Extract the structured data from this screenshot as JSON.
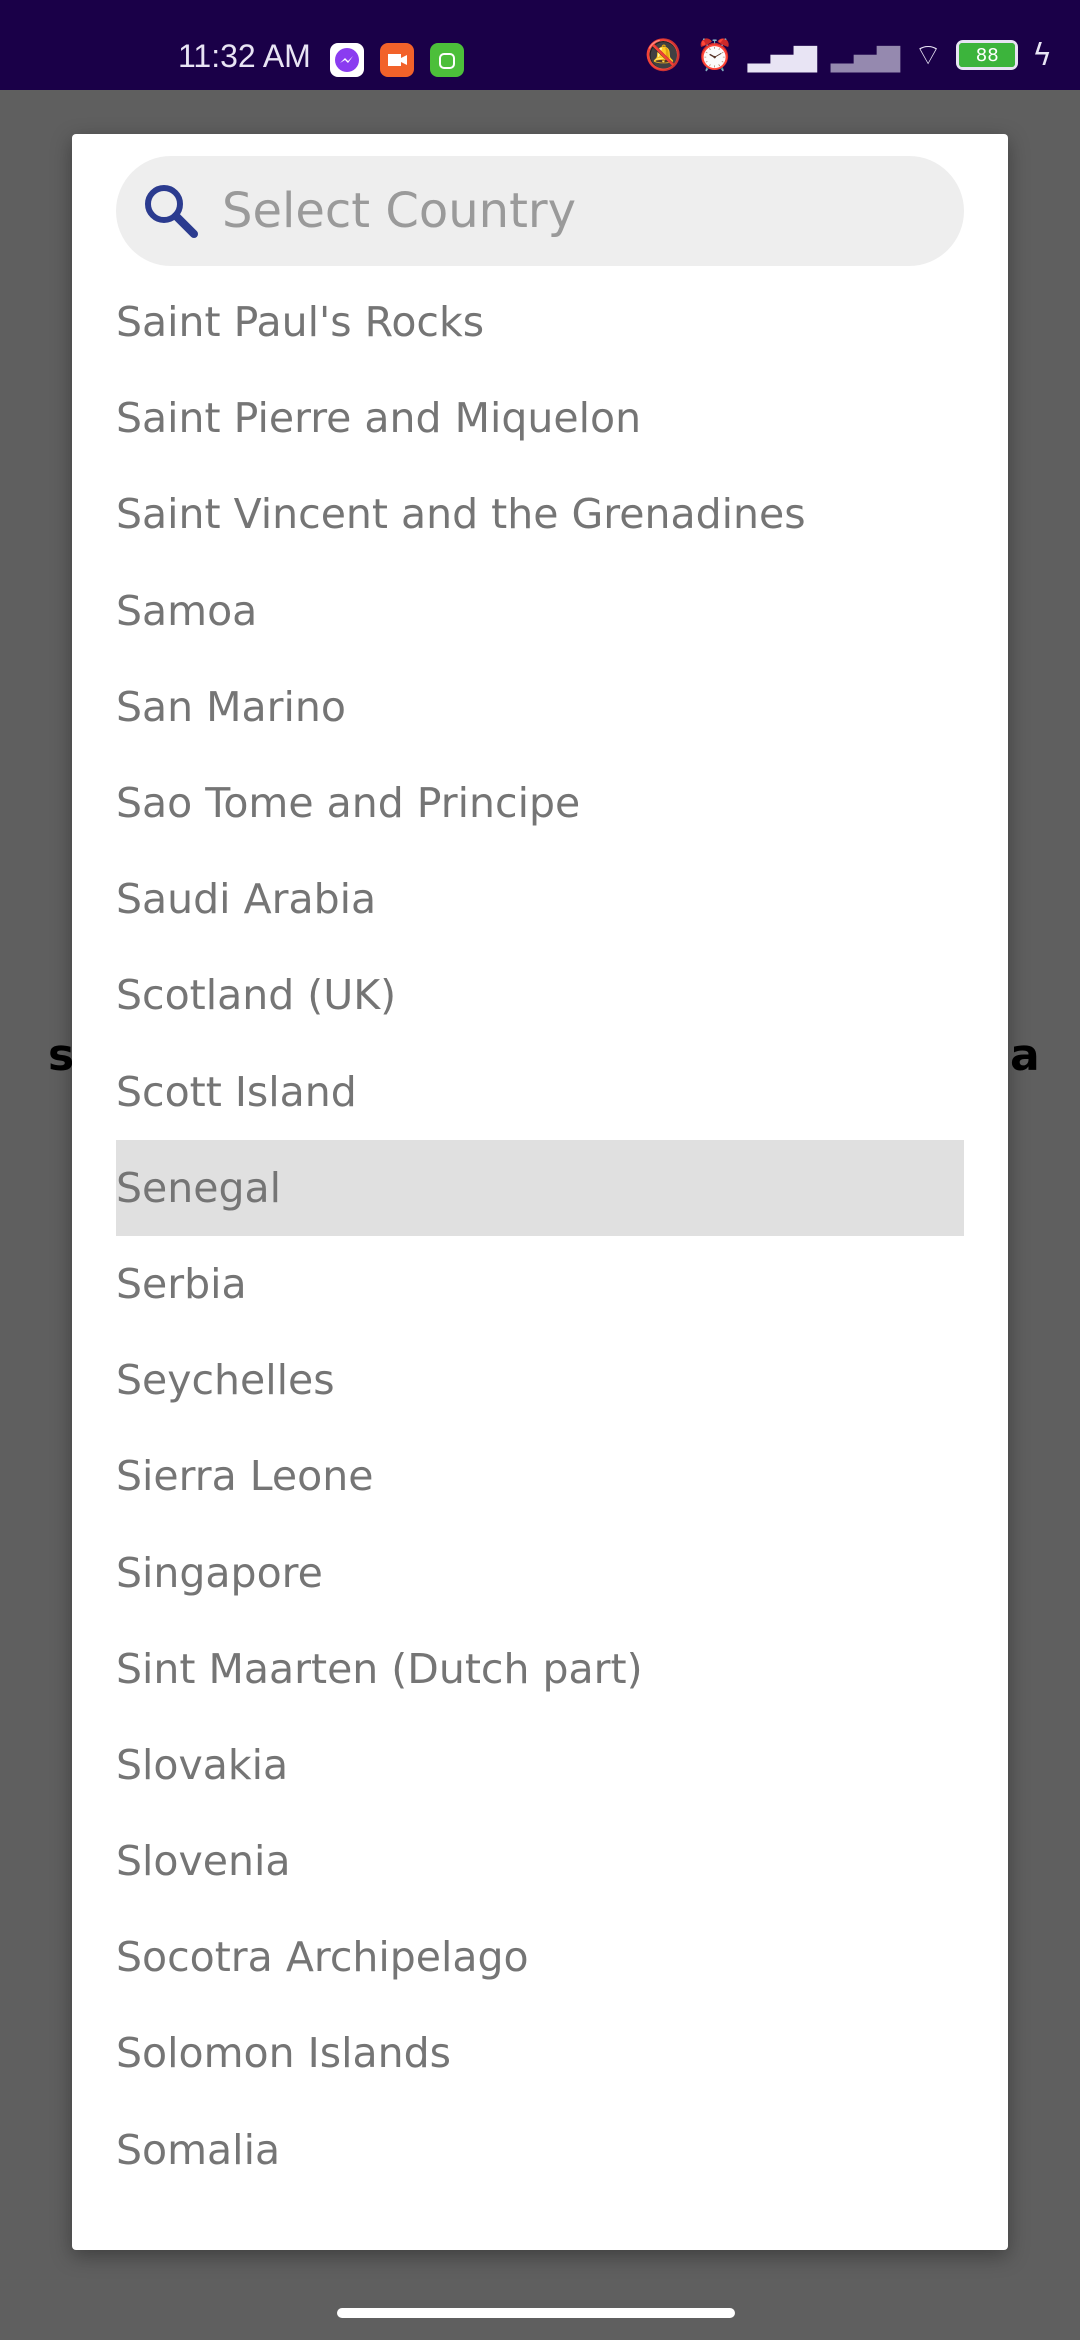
{
  "status_bar": {
    "time": "11:32 AM",
    "battery": "88",
    "notification_icons": [
      "messenger-icon",
      "video-call-icon",
      "android-app-icon"
    ],
    "system_icons": [
      "bell-muted-icon",
      "alarm-icon",
      "signal-icon",
      "signal-icon",
      "wifi-icon",
      "battery-icon",
      "charging-icon"
    ],
    "background_color": "#1a0048"
  },
  "background": {
    "fragment_left": "s",
    "fragment_right": "a"
  },
  "dialog": {
    "search": {
      "placeholder": "Select Country",
      "value": ""
    },
    "selected": "Senegal",
    "countries": [
      "Saint Paul's Rocks",
      "Saint Pierre and Miquelon",
      "Saint Vincent and the Grenadines",
      "Samoa",
      "San Marino",
      "Sao Tome and Principe",
      "Saudi Arabia",
      "Scotland (UK)",
      "Scott Island",
      "Senegal",
      "Serbia",
      "Seychelles",
      "Sierra Leone",
      "Singapore",
      "Sint Maarten (Dutch part)",
      "Slovakia",
      "Slovenia",
      "Socotra Archipelago",
      "Solomon Islands",
      "Somalia"
    ]
  },
  "colors": {
    "text": "#757575",
    "highlight": "#e0e0e0",
    "search_icon": "#2b3b8f",
    "scrim": "#5f5f5f"
  }
}
